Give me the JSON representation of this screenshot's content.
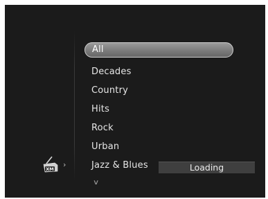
{
  "menu": {
    "items": [
      {
        "label": "All",
        "selected": true
      },
      {
        "label": "Decades",
        "selected": false
      },
      {
        "label": "Country",
        "selected": false
      },
      {
        "label": "Hits",
        "selected": false
      },
      {
        "label": "Rock",
        "selected": false
      },
      {
        "label": "Urban",
        "selected": false
      },
      {
        "label": "Jazz & Blues",
        "selected": false
      }
    ],
    "more_indicator": "∨"
  },
  "source": {
    "logo_text": "XM",
    "chevron": "›",
    "icon": "xm-antenna-icon"
  },
  "status": {
    "text": "Loading"
  },
  "colors": {
    "background": "#1b1b1b",
    "text": "#e6e6e6",
    "highlight": "#808080"
  }
}
